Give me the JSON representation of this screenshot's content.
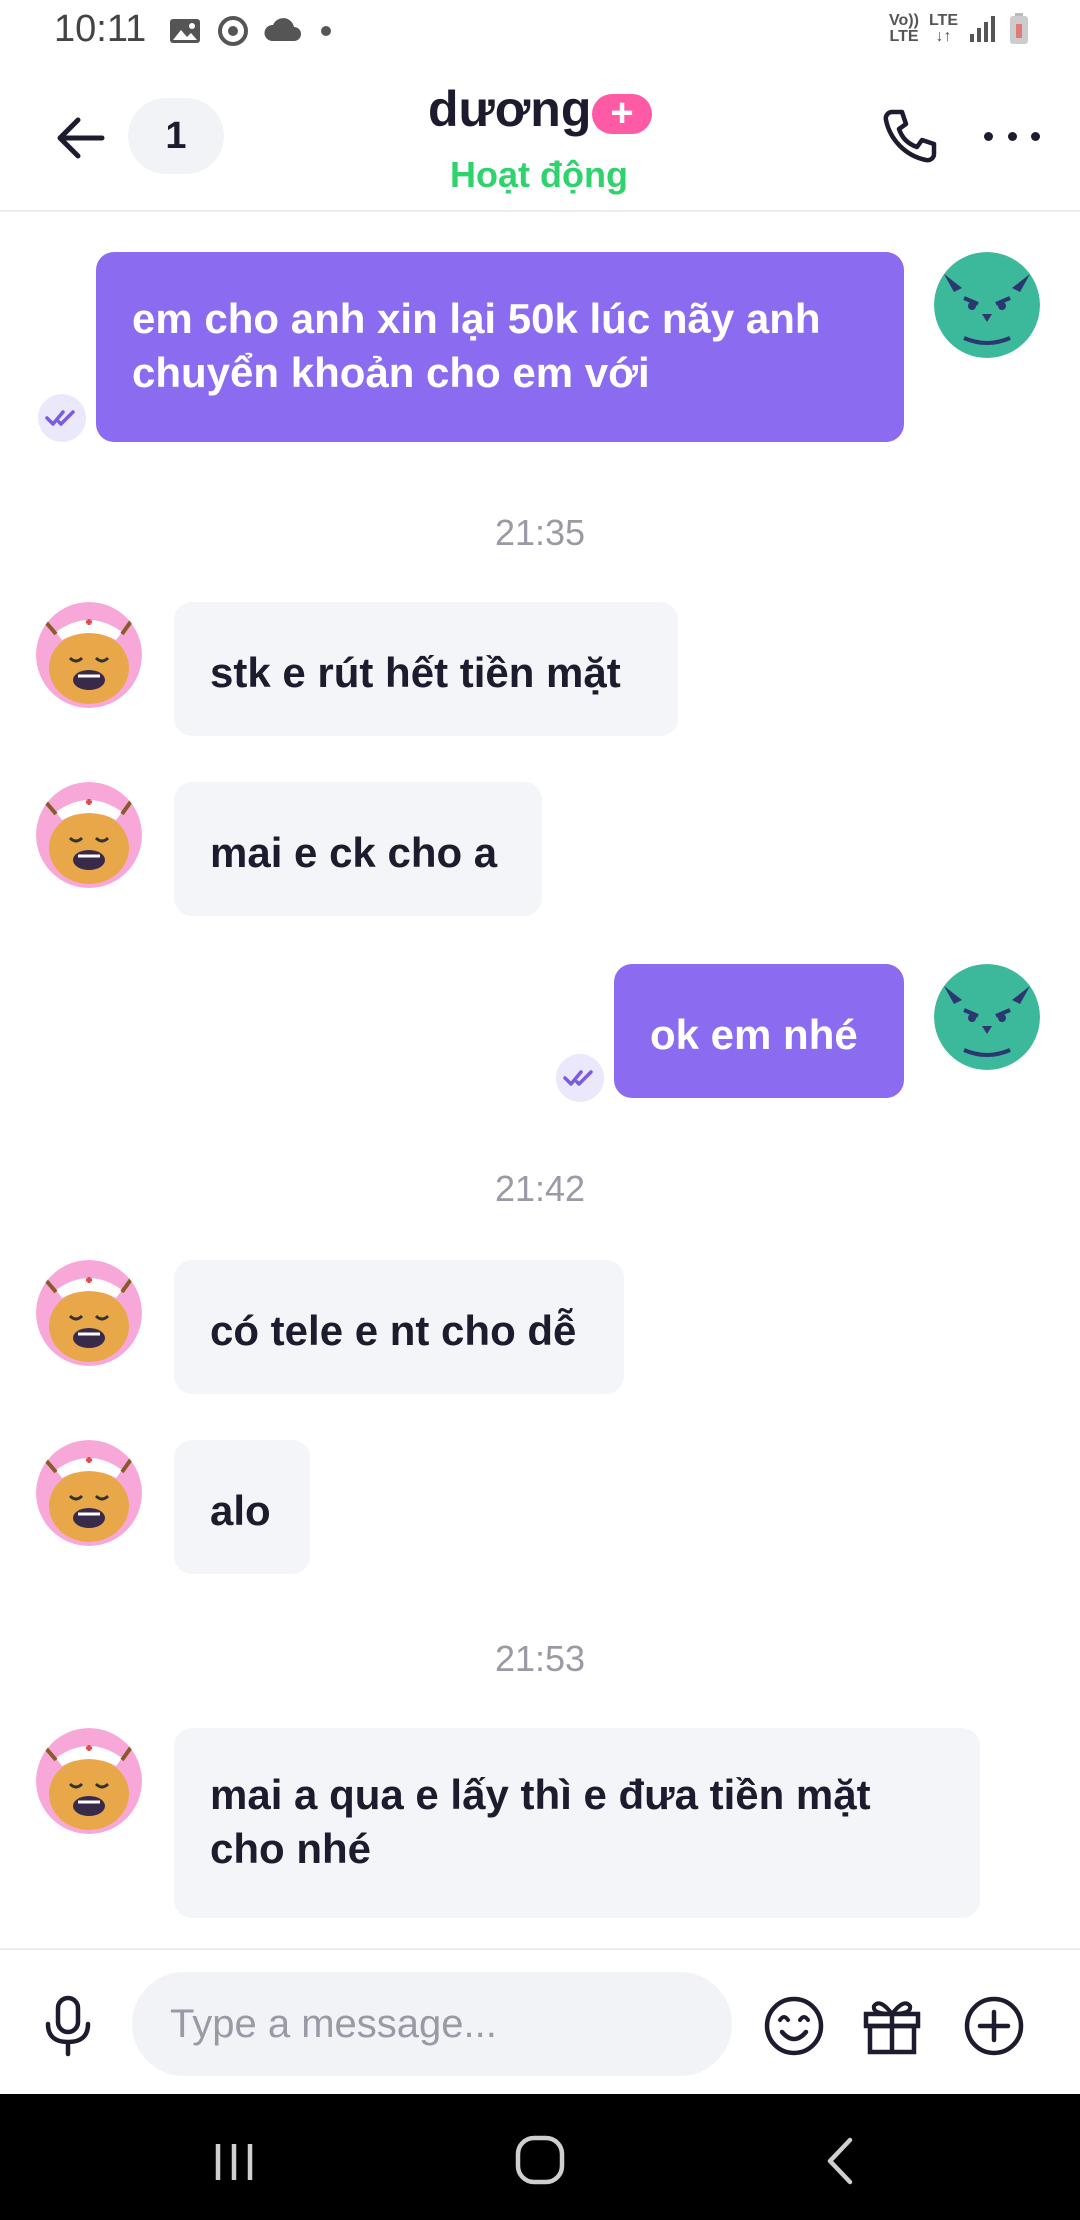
{
  "status_bar": {
    "time": "10:11",
    "volte_top": "Vo))",
    "volte_bottom": "LTE",
    "lte_top": "LTE",
    "lte_bottom": "↓↑"
  },
  "header": {
    "unread_count": "1",
    "contact_name": "dương",
    "plus_badge": "+",
    "status": "Hoạt động"
  },
  "colors": {
    "accent": "#8b6cf0",
    "online": "#2ed36b",
    "badge": "#ff5aa5",
    "incoming_bubble": "#f4f5f8"
  },
  "messages": [
    {
      "direction": "out",
      "text": "em cho anh xin lại 50k lúc nãy anh chuyển khoản cho em với",
      "seen": true
    },
    {
      "type": "time",
      "text": "21:35"
    },
    {
      "direction": "in",
      "text": "stk e rút hết tiền mặt"
    },
    {
      "direction": "in",
      "text": "mai e ck cho a"
    },
    {
      "direction": "out",
      "text": "ok em nhé",
      "seen": true
    },
    {
      "type": "time",
      "text": "21:42"
    },
    {
      "direction": "in",
      "text": "có tele e nt cho dễ"
    },
    {
      "direction": "in",
      "text": "alo"
    },
    {
      "type": "time",
      "text": "21:53"
    },
    {
      "direction": "in",
      "text": "mai a qua e lấy thì e đưa tiền mặt cho nhé"
    }
  ],
  "composer": {
    "placeholder": "Type a message..."
  },
  "icons": {
    "back": "arrow-left-icon",
    "call": "phone-icon",
    "more": "more-horizontal-icon",
    "mic": "microphone-icon",
    "emoji": "smiley-icon",
    "gift": "gift-icon",
    "plus": "plus-circle-icon"
  }
}
